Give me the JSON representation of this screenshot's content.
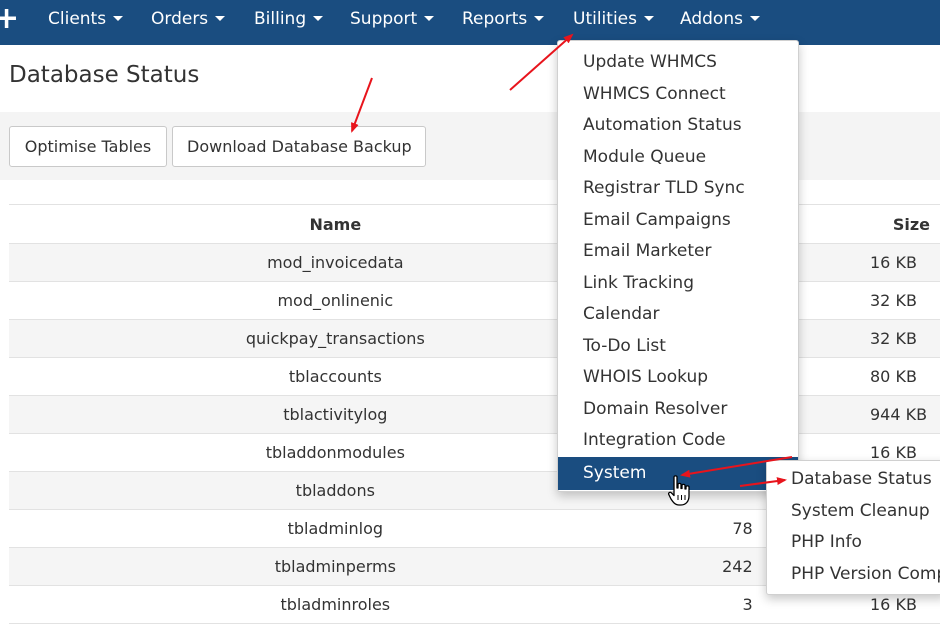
{
  "nav": {
    "plus": "+",
    "items": [
      {
        "label": "Clients"
      },
      {
        "label": "Orders"
      },
      {
        "label": "Billing"
      },
      {
        "label": "Support"
      },
      {
        "label": "Reports"
      },
      {
        "label": "Utilities"
      },
      {
        "label": "Addons"
      }
    ]
  },
  "page": {
    "title": "Database Status"
  },
  "toolbar": {
    "optimise_label": "Optimise Tables",
    "backup_label": "Download Database Backup"
  },
  "table": {
    "headers": {
      "name": "Name",
      "rows": "",
      "size": "Size"
    },
    "rows": [
      {
        "name": "mod_invoicedata",
        "rows": "",
        "size": "16 KB"
      },
      {
        "name": "mod_onlinenic",
        "rows": "",
        "size": "32 KB"
      },
      {
        "name": "quickpay_transactions",
        "rows": "",
        "size": "32 KB"
      },
      {
        "name": "tblaccounts",
        "rows": "",
        "size": "80 KB"
      },
      {
        "name": "tblactivitylog",
        "rows": "",
        "size": "944 KB"
      },
      {
        "name": "tbladdonmodules",
        "rows": "",
        "size": "16 KB"
      },
      {
        "name": "tbladdons",
        "rows": "",
        "size": ""
      },
      {
        "name": "tbladminlog",
        "rows": "78",
        "size": ""
      },
      {
        "name": "tbladminperms",
        "rows": "242",
        "size": ""
      },
      {
        "name": "tbladminroles",
        "rows": "3",
        "size": "16 KB"
      }
    ]
  },
  "utilities_menu": {
    "items": [
      {
        "label": "Update WHMCS"
      },
      {
        "label": "WHMCS Connect"
      },
      {
        "label": "Automation Status"
      },
      {
        "label": "Module Queue"
      },
      {
        "label": "Registrar TLD Sync"
      },
      {
        "label": "Email Campaigns"
      },
      {
        "label": "Email Marketer"
      },
      {
        "label": "Link Tracking"
      },
      {
        "label": "Calendar"
      },
      {
        "label": "To-Do List"
      },
      {
        "label": "WHOIS Lookup"
      },
      {
        "label": "Domain Resolver"
      },
      {
        "label": "Integration Code"
      },
      {
        "label": "System"
      }
    ],
    "active_index": 13
  },
  "system_submenu": {
    "items": [
      {
        "label": "Database Status"
      },
      {
        "label": "System Cleanup"
      },
      {
        "label": "PHP Info"
      },
      {
        "label": "PHP Version Comp"
      }
    ]
  },
  "colors": {
    "nav_bg": "#1a4d80",
    "annotation_arrow": "#e8141c",
    "row_alt": "#f5f5f5"
  },
  "icons": {
    "cursor": "hand-pointer-icon",
    "caret": "caret-down-icon"
  }
}
